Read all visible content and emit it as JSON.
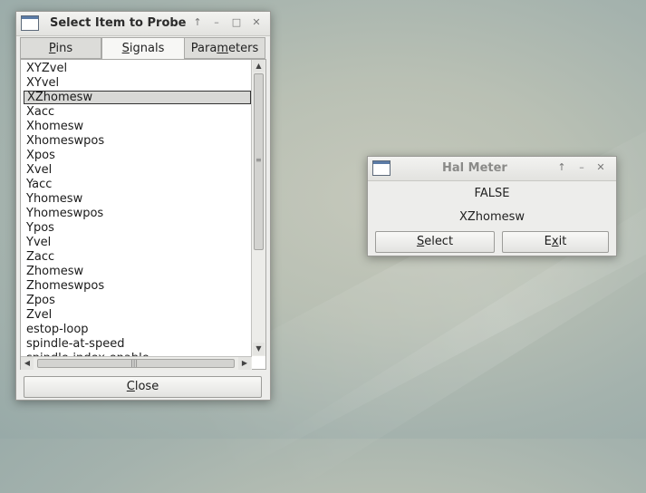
{
  "probe_window": {
    "title": "Select Item to Probe",
    "title_buttons": [
      "↑",
      "–",
      "□",
      "✕"
    ],
    "tabs": [
      {
        "label": "Pins",
        "mnemonic": "P"
      },
      {
        "label": "Signals",
        "mnemonic": "S"
      },
      {
        "label": "Parameters",
        "mnemonic": "m"
      }
    ],
    "active_tab": "Signals",
    "signals": [
      "XYZvel",
      "XYvel",
      "XZhomesw",
      "Xacc",
      "Xhomesw",
      "Xhomeswpos",
      "Xpos",
      "Xvel",
      "Yacc",
      "Yhomesw",
      "Yhomeswpos",
      "Ypos",
      "Yvel",
      "Zacc",
      "Zhomesw",
      "Zhomeswpos",
      "Zpos",
      "Zvel",
      "estop-loop",
      "spindle-at-speed",
      "spindle-index-enable"
    ],
    "selected_signal": "XZhomesw",
    "close_label": "Close"
  },
  "meter_window": {
    "title": "Hal Meter",
    "title_buttons": [
      "↑",
      "–",
      "✕"
    ],
    "value": "FALSE",
    "signal_name": "XZhomesw",
    "select_label": "Select",
    "exit_label": "Exit"
  },
  "colors": {
    "selection_bg": "#d8d8d6",
    "window_bg": "#ededeb",
    "desktop": "#b9c0b4"
  }
}
